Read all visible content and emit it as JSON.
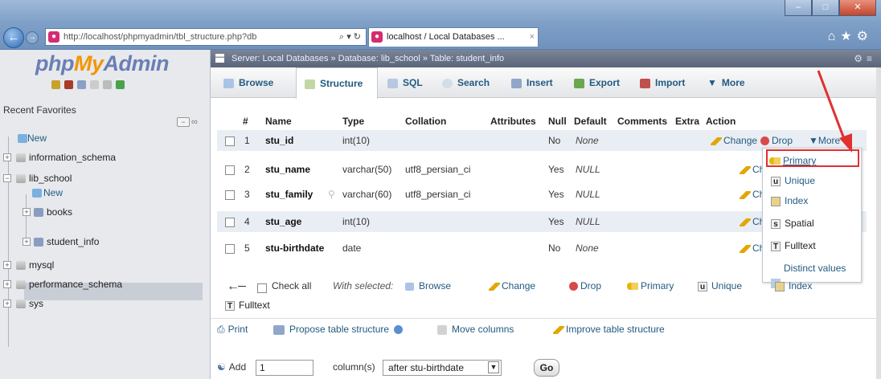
{
  "browser": {
    "address": "http://localhost/phpmyadmin/tbl_structure.php?db",
    "address_host": "localhost",
    "tab_title": "localhost / Local Databases ..."
  },
  "sidebar": {
    "logo_php": "php",
    "logo_my": "My",
    "logo_admin": "Admin",
    "recent_favorites": "Recent  Favorites",
    "tree": {
      "new": "New",
      "information_schema": "information_schema",
      "lib_school": "lib_school",
      "lib_new": "New",
      "books": "books",
      "student_info": "student_info",
      "mysql": "mysql",
      "performance_schema": "performance_schema",
      "sys": "sys"
    }
  },
  "breadcrumb": "Server: Local Databases »  Database: lib_school »  Table: student_info",
  "menu": {
    "browse": "Browse",
    "structure": "Structure",
    "sql": "SQL",
    "search": "Search",
    "insert": "Insert",
    "export": "Export",
    "import": "Import",
    "more": "More"
  },
  "table": {
    "headers": {
      "num": "#",
      "name": "Name",
      "type": "Type",
      "collation": "Collation",
      "attributes": "Attributes",
      "null": "Null",
      "default": "Default",
      "comments": "Comments",
      "extra": "Extra",
      "action": "Action"
    },
    "rows": [
      {
        "num": "1",
        "name": "stu_id",
        "type": "int(10)",
        "collation": "",
        "null": "No",
        "default": "None"
      },
      {
        "num": "2",
        "name": "stu_name",
        "type": "varchar(50)",
        "collation": "utf8_persian_ci",
        "null": "Yes",
        "default": "NULL"
      },
      {
        "num": "3",
        "name": "stu_family",
        "type": "varchar(60)",
        "collation": "utf8_persian_ci",
        "null": "Yes",
        "default": "NULL"
      },
      {
        "num": "4",
        "name": "stu_age",
        "type": "int(10)",
        "collation": "",
        "null": "Yes",
        "default": "NULL"
      },
      {
        "num": "5",
        "name": "stu-birthdate",
        "type": "date",
        "collation": "",
        "null": "No",
        "default": "None"
      }
    ],
    "actions": {
      "change": "Change",
      "change_short": "Chang",
      "drop": "Drop",
      "more": "More"
    }
  },
  "dropdown": {
    "primary": "Primary",
    "unique": "Unique",
    "index": "Index",
    "spatial": "Spatial",
    "fulltext": "Fulltext",
    "distinct": "Distinct values"
  },
  "bulk": {
    "check_all": "Check all",
    "with_selected": "With selected:",
    "browse": "Browse",
    "change": "Change",
    "drop": "Drop",
    "primary": "Primary",
    "unique": "Unique",
    "index": "Index",
    "fulltext": "Fulltext"
  },
  "links": {
    "print": "Print",
    "propose": "Propose table structure",
    "move_columns": "Move columns",
    "improve": "Improve table structure"
  },
  "add_column": {
    "label": "Add",
    "count": "1",
    "columns_label": "column(s)",
    "position": "after stu-birthdate",
    "go": "Go"
  },
  "colors": {
    "link": "#235a81",
    "row_odd": "#e9eef4",
    "highlight_border": "#e03030",
    "logo_orange": "#f29600",
    "logo_blue": "#6b7fb5"
  }
}
